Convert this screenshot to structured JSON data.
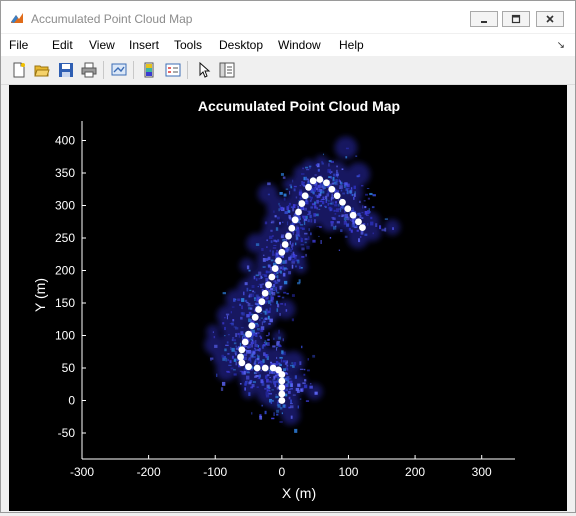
{
  "window": {
    "title": "Accumulated Point Cloud Map"
  },
  "menu": {
    "items": [
      "File",
      "Edit",
      "View",
      "Insert",
      "Tools",
      "Desktop",
      "Window",
      "Help"
    ]
  },
  "toolbar": {
    "buttons": [
      "new-figure-icon",
      "open-file-icon",
      "save-icon",
      "print-icon",
      "link-plot-icon",
      "insert-colorbar-icon",
      "insert-legend-icon",
      "pointer-icon",
      "plot-tools-icon"
    ]
  },
  "colors": {
    "background": "#000000",
    "points": "#3d3bd6",
    "trajectory": "#ffffff",
    "axes": "#ffffff"
  },
  "chart_data": {
    "type": "scatter",
    "title": "Accumulated Point Cloud Map",
    "xlabel": "X (m)",
    "ylabel": "Y (m)",
    "xlim": [
      -300,
      350
    ],
    "ylim": [
      -90,
      430
    ],
    "xticks": [
      -300,
      -200,
      -100,
      0,
      100,
      200,
      300
    ],
    "yticks": [
      -50,
      0,
      50,
      100,
      150,
      200,
      250,
      300,
      350,
      400
    ],
    "grid": false,
    "series": [
      {
        "type": "trajectory",
        "values": [
          [
            0,
            0
          ],
          [
            0,
            10
          ],
          [
            0,
            20
          ],
          [
            0,
            30
          ],
          [
            0,
            40
          ],
          [
            -5,
            47
          ],
          [
            -13,
            50
          ],
          [
            -25,
            50
          ],
          [
            -37,
            50
          ],
          [
            -50,
            52
          ],
          [
            -60,
            58
          ],
          [
            -62,
            67
          ],
          [
            -60,
            78
          ],
          [
            -55,
            90
          ],
          [
            -50,
            102
          ],
          [
            -45,
            115
          ],
          [
            -40,
            128
          ],
          [
            -35,
            140
          ],
          [
            -30,
            152
          ],
          [
            -25,
            165
          ],
          [
            -20,
            178
          ],
          [
            -15,
            190
          ],
          [
            -10,
            203
          ],
          [
            -5,
            215
          ],
          [
            0,
            228
          ],
          [
            5,
            240
          ],
          [
            10,
            253
          ],
          [
            15,
            265
          ],
          [
            20,
            278
          ],
          [
            25,
            290
          ],
          [
            30,
            303
          ],
          [
            35,
            315
          ],
          [
            40,
            328
          ],
          [
            47,
            338
          ],
          [
            57,
            340
          ],
          [
            67,
            335
          ],
          [
            75,
            325
          ],
          [
            83,
            315
          ],
          [
            91,
            305
          ],
          [
            99,
            295
          ],
          [
            107,
            285
          ],
          [
            115,
            275
          ],
          [
            121,
            266
          ]
        ]
      }
    ]
  }
}
